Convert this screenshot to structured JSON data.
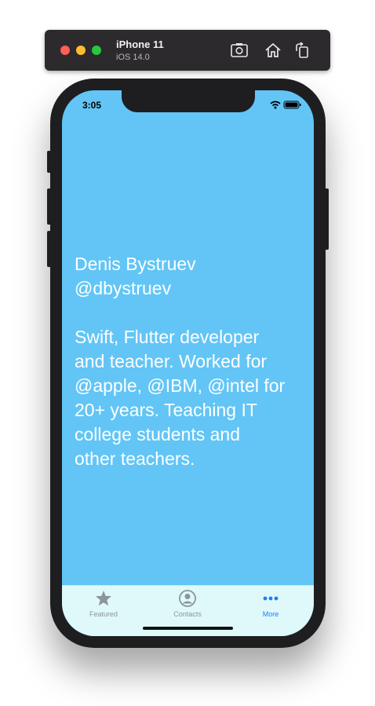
{
  "simulator": {
    "device_name": "iPhone 11",
    "os_version": "iOS 14.0"
  },
  "status_bar": {
    "time": "3:05"
  },
  "profile": {
    "bio_text": "Denis Bystruev\n@dbystruev\n\nSwift, Flutter developer\nand teacher. Worked for\n@apple, @IBM, @intel for\n20+ years. Teaching IT\ncollege students and\nother teachers."
  },
  "tab_bar": {
    "tabs": [
      {
        "label": "Featured",
        "icon": "star-icon"
      },
      {
        "label": "Contacts",
        "icon": "person-circle-icon"
      },
      {
        "label": "More",
        "icon": "ellipsis-icon",
        "selected": true
      }
    ]
  },
  "colors": {
    "background": "#62c5f6",
    "tab_bar": "#dff9fb",
    "accent": "#1a7ff3"
  }
}
